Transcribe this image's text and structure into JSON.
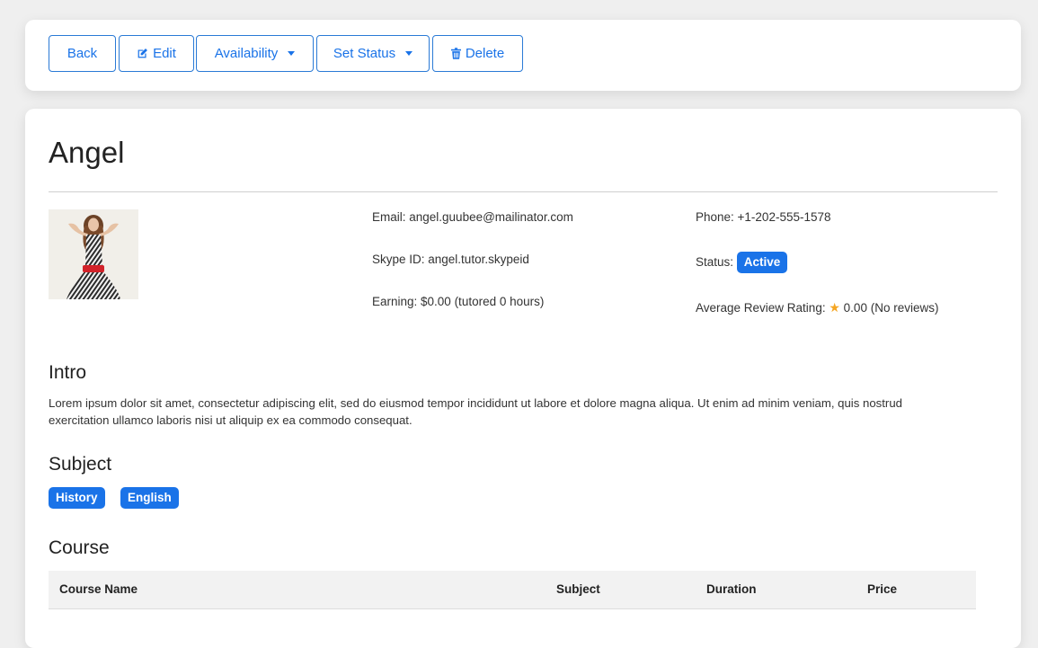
{
  "toolbar": {
    "back_label": "Back",
    "edit_label": "Edit",
    "availability_label": "Availability",
    "set_status_label": "Set Status",
    "delete_label": "Delete"
  },
  "profile": {
    "name": "Angel",
    "email": "Email: angel.guubee@mailinator.com",
    "skype": "Skype ID: angel.tutor.skypeid",
    "earning": "Earning: $0.00 (tutored 0 hours)",
    "phone": "Phone: +1-202-555-1578",
    "status_label": "Status:",
    "status_value": "Active",
    "rating_label": "Average Review Rating:",
    "rating_value": "0.00 (No reviews)"
  },
  "intro": {
    "heading": "Intro",
    "text": "Lorem ipsum dolor sit amet, consectetur adipiscing elit, sed do eiusmod tempor incididunt ut labore et dolore magna aliqua. Ut enim ad minim veniam, quis nostrud exercitation ullamco laboris nisi ut aliquip ex ea commodo consequat."
  },
  "subject": {
    "heading": "Subject",
    "items": [
      "History",
      "English"
    ]
  },
  "course": {
    "heading": "Course",
    "columns": [
      "Course Name",
      "Subject",
      "Duration",
      "Price"
    ]
  },
  "colors": {
    "accent": "#1a73e8",
    "star": "#f5a623"
  },
  "icons": [
    "edit-icon",
    "trash-icon",
    "caret-down-icon",
    "star-icon"
  ]
}
